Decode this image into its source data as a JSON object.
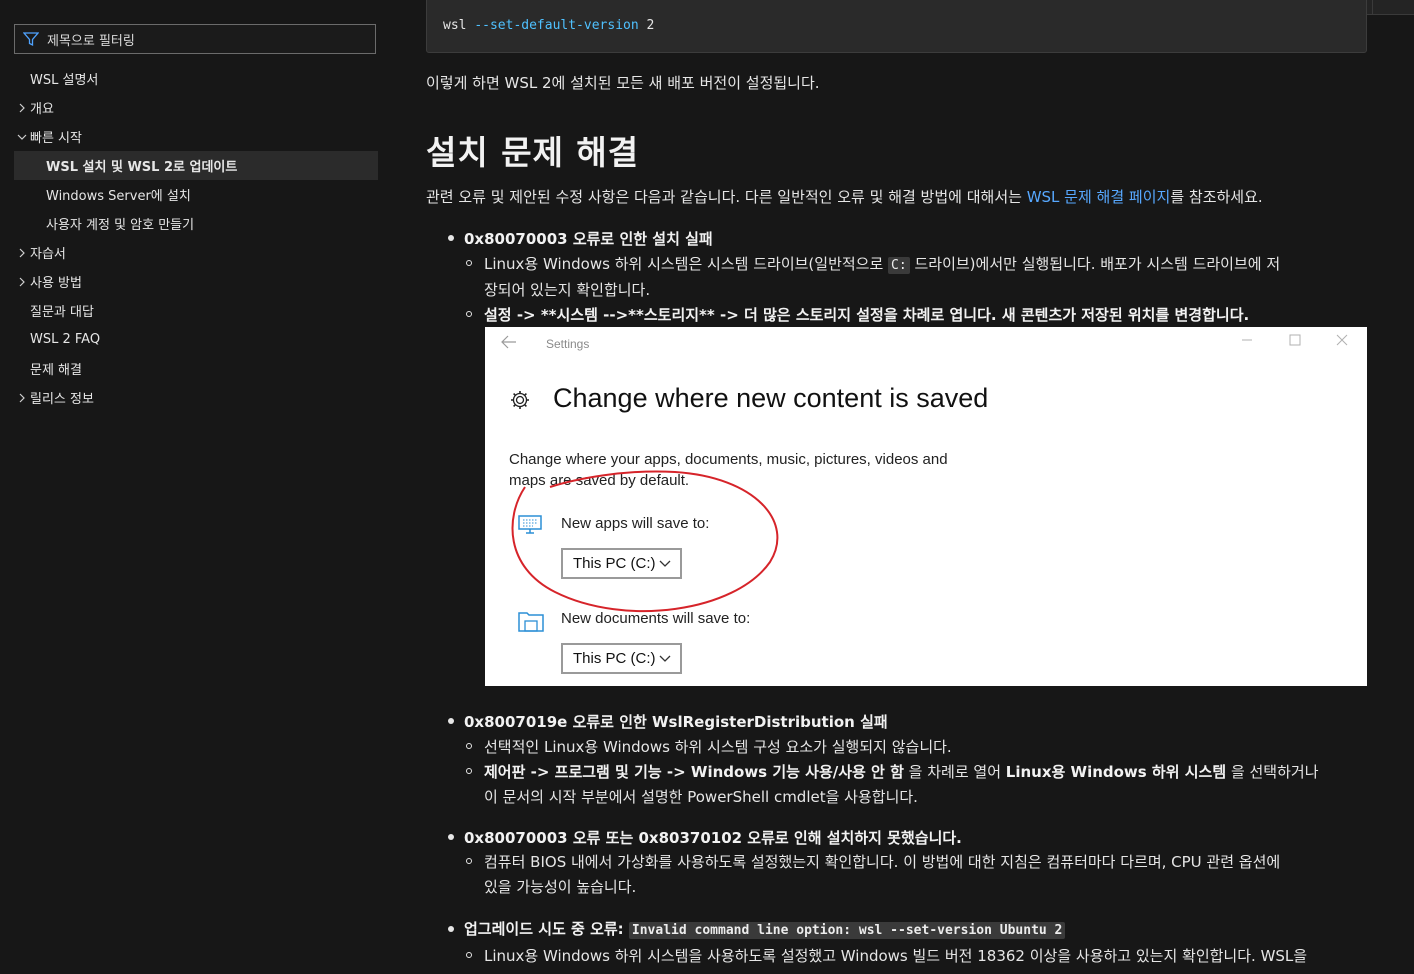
{
  "sidebar": {
    "filter_placeholder": "제목으로 필터링",
    "items": [
      {
        "label": "WSL 설명서",
        "chevron": ""
      },
      {
        "label": "개요",
        "chevron": "›"
      },
      {
        "label": "빠른 시작",
        "chevron": "⌄"
      },
      {
        "label": "WSL 설치 및 WSL 2로 업데이트",
        "chevron": "",
        "active": true
      },
      {
        "label": "Windows Server에 설치",
        "chevron": ""
      },
      {
        "label": "사용자 계정 및 암호 만들기",
        "chevron": ""
      },
      {
        "label": "자습서",
        "chevron": "›"
      },
      {
        "label": "사용 방법",
        "chevron": "›"
      },
      {
        "label": "질문과 대답",
        "chevron": ""
      },
      {
        "label": "WSL 2 FAQ",
        "chevron": ""
      },
      {
        "label": "문제 해결",
        "chevron": ""
      },
      {
        "label": "릴리스 정보",
        "chevron": "›"
      }
    ]
  },
  "main": {
    "code": {
      "cmd": "wsl",
      "flag": "--set-default-version",
      "arg": "2"
    },
    "p1": "이렇게 하면 WSL 2에 설치된 모든 새 배포 버전이 설정됩니다.",
    "heading": "설치 문제 해결",
    "p2_before": "관련 오류 및 제안된 수정 사항은 다음과 같습니다. 다른 일반적인 오류 및 해결 방법에 대해서는 ",
    "p2_link": "WSL 문제 해결 페이지",
    "p2_after": "를 참조하세요.",
    "issue1": {
      "title": "0x80070003 오류로 인한 설치 실패",
      "s1_a": "Linux용 Windows 하위 시스템은 시스템 드라이브(일반적으로 ",
      "s1_code": "C:",
      "s1_b": " 드라이브)에서만 실행됩니다. 배포가 시스템 드라이브에 저",
      "s1_c": "장되어 있는지 확인합니다.",
      "s2": "설정 -> **시스템 -->**스토리지** -> 더 많은 스토리지 설정을 차례로 엽니다. 새 콘텐츠가 저장된 위치를 변경합니다."
    },
    "screenshot": {
      "window_title": "Settings",
      "heading": "Change where new content is saved",
      "desc": "Change where your apps, documents, music, pictures, videos and maps are saved by default.",
      "apps_label": "New apps will save to:",
      "apps_value": "This PC (C:)",
      "docs_label": "New documents will save to:",
      "docs_value": "This PC (C:)"
    },
    "issue2": {
      "title": "0x8007019e 오류로 인한 WslRegisterDistribution 실패",
      "s1": "선택적인 Linux용 Windows 하위 시스템 구성 요소가 실행되지 않습니다.",
      "s2_b1": "제어판 -> 프로그램 및 기능 -> Windows 기능 사용/사용 안 함",
      "s2_t1": " 을 차례로 열어 ",
      "s2_b2": "Linux용 Windows 하위 시스템",
      "s2_t2": " 을 선택하거나",
      "s2_c": "이 문서의 시작 부분에서 설명한 PowerShell cmdlet을 사용합니다."
    },
    "issue3": {
      "title": "0x80070003 오류 또는 0x80370102 오류로 인해 설치하지 못했습니다.",
      "s1_a": "컴퓨터 BIOS 내에서 가상화를 사용하도록 설정했는지 확인합니다. 이 방법에 대한 지침은 컴퓨터마다 다르며, CPU 관련 옵션에",
      "s1_b": "있을 가능성이 높습니다."
    },
    "issue4": {
      "title": "업그레이드 시도 중 오류:",
      "code": "Invalid command line option: wsl --set-version Ubuntu 2",
      "s1": "Linux용 Windows 하위 시스템을 사용하도록 설정했고 Windows 빌드 버전 18362 이상을 사용하고 있는지 확인합니다. WSL을"
    }
  }
}
